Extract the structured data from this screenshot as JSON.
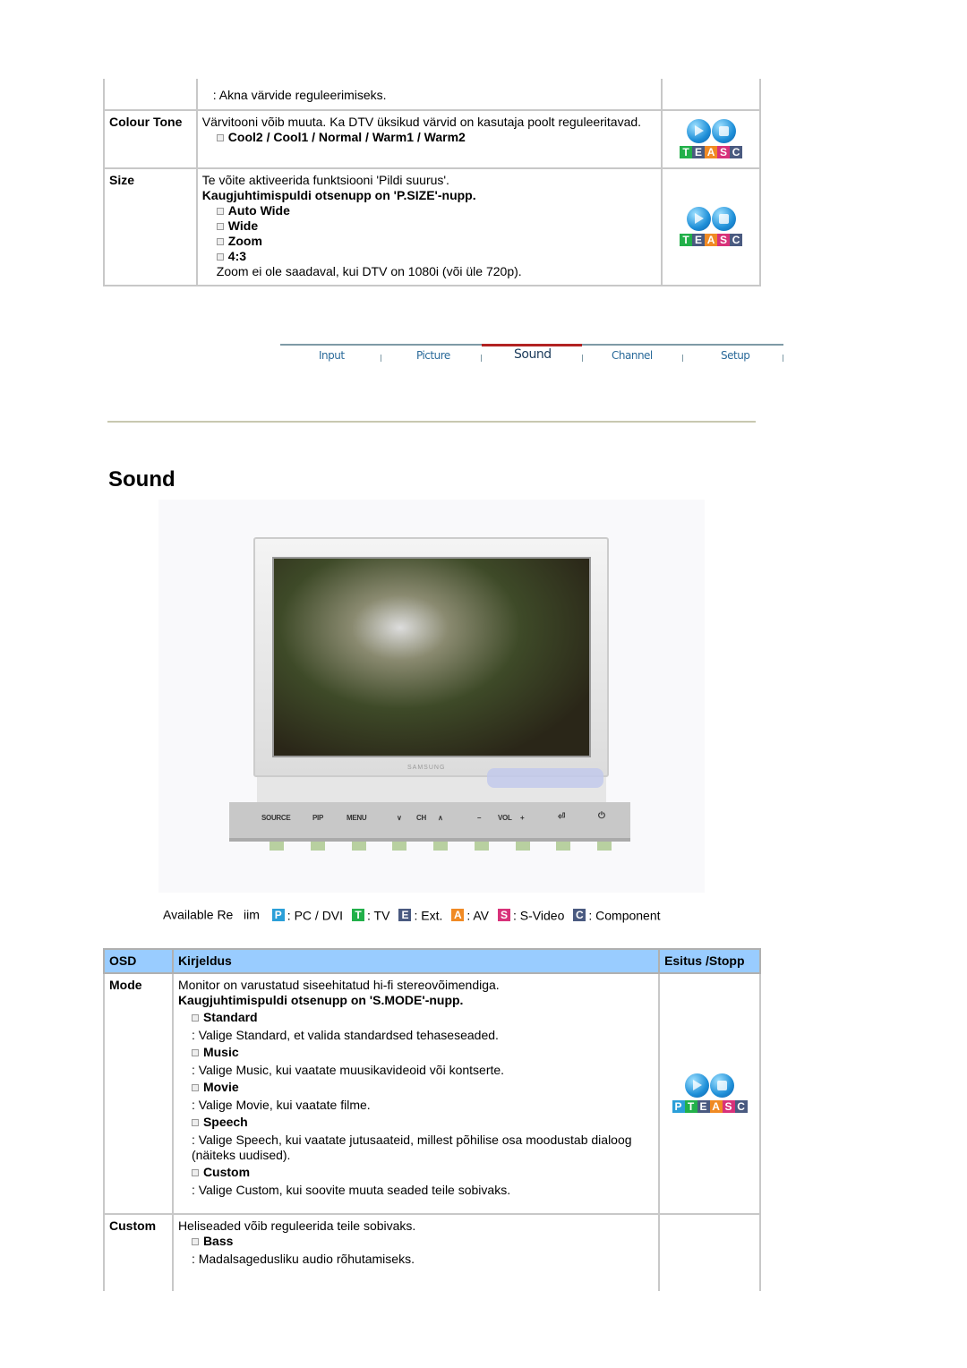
{
  "top_table": {
    "rows": [
      {
        "label": "",
        "desc": ": Akna värvide reguleerimiseks."
      },
      {
        "label": "Colour Tone",
        "desc": "Värvitooni võib muuta. Ka DTV üksikud värvid on kasutaja poolt reguleeritavad.",
        "options": "Cool2 / Cool1 / Normal / Warm1 / Warm2",
        "modes": "TEASC"
      },
      {
        "label": "Size",
        "desc": "Te võite aktiveerida funktsiooni 'Pildi suurus'.",
        "remote": "Kaugjuhtimispuldi otsenupp on 'P.SIZE'-nupp.",
        "options": [
          "Auto Wide",
          "Wide",
          "Zoom",
          "4:3"
        ],
        "note": "Zoom ei ole saadaval, kui DTV on 1080i (või üle 720p).",
        "modes": "TEASC"
      }
    ]
  },
  "nav": {
    "tabs": [
      "Input",
      "Picture",
      "Sound",
      "Channel",
      "Setup"
    ],
    "active": "Sound",
    "active_color": "#b22222"
  },
  "page_title": "Sound",
  "monitor": {
    "brand": "SAMSUNG",
    "buttons": [
      "SOURCE",
      "PIP",
      "MENU",
      "CH",
      "VOL"
    ]
  },
  "legend": {
    "label": "Available Re   iim",
    "items": [
      {
        "letter": "P",
        "text": ": PC / DVI",
        "color": "#2b9fd8"
      },
      {
        "letter": "T",
        "text": ": TV",
        "color": "#22b04a"
      },
      {
        "letter": "E",
        "text": ": Ext.",
        "color": "#4a5a80"
      },
      {
        "letter": "A",
        "text": ": AV",
        "color": "#f08a24"
      },
      {
        "letter": "S",
        "text": ": S-Video",
        "color": "#d8327a"
      },
      {
        "letter": "C",
        "text": ": Component",
        "color": "#4a5a80"
      }
    ]
  },
  "sound_table": {
    "headers": [
      "OSD",
      "Kirjeldus",
      "Esitus /Stopp"
    ],
    "header_color": "#99ccff",
    "mode": {
      "label": "Mode",
      "desc": "Monitor on varustatud siseehitatud hi-fi stereovõimendiga.",
      "remote": "Kaugjuhtimispuldi otsenupp on 'S.MODE'-nupp.",
      "options": [
        {
          "name": "Standard",
          "desc": ": Valige Standard, et valida standardsed tehaseseaded."
        },
        {
          "name": "Music",
          "desc": ": Valige Music, kui vaatate muusikavideoid või kontserte."
        },
        {
          "name": "Movie",
          "desc": ": Valige Movie, kui vaatate filme."
        },
        {
          "name": "Speech",
          "desc": ": Valige Speech, kui vaatate jutusaateid, millest põhilise osa moodustab dialoog (näiteks uudised)."
        },
        {
          "name": "Custom",
          "desc": ": Valige Custom, kui soovite muuta seaded teile sobivaks."
        }
      ],
      "modes": "PTEASC"
    },
    "custom": {
      "label": "Custom",
      "desc": "Heliseaded võib reguleerida teile sobivaks.",
      "options": [
        {
          "name": "Bass",
          "desc": ": Madalsagedusliku audio rõhutamiseks."
        }
      ]
    }
  }
}
